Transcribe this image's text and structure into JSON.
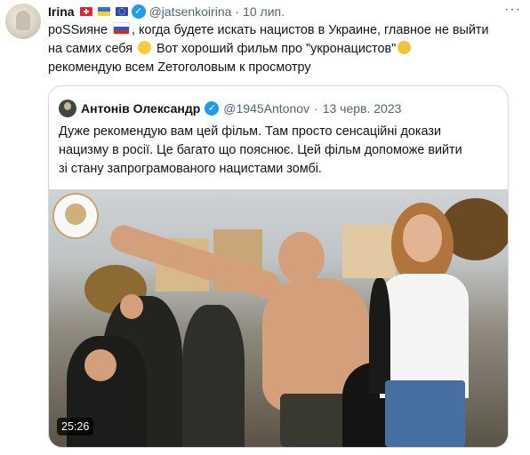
{
  "tweet": {
    "author_name": "Irina",
    "author_handle": "@jatsenkoirina",
    "separator": "·",
    "timestamp": "10 лип.",
    "more_label": "···",
    "lines": [
      "poSSиянe, когда будете искать нацистов в Украине, главное не выйти",
      "на самих себя  Вот хороший фильм про \"укронацистов\"",
      "рекомендую всем Zетоголовым к просмотру"
    ],
    "line1_start": "poSSиянe",
    "line1_end": ", когда будете искать нацистов в Украине, главное не выйти",
    "line2_start": "на самих себя",
    "line2_end": "Вот хороший фильм про \"укронацистов\"",
    "line3": "рекомендую всем Zетоголовым к просмотру"
  },
  "quote": {
    "author_name": "Антонів Олександр",
    "author_handle": "@1945Antonov",
    "separator": "·",
    "timestamp": "13 черв. 2023",
    "text_lines": [
      "Дуже рекомендую вам цей фільм. Там просто сенсаційні докази",
      "нацизму в росії. Це багато що пояснює. Цей фільм допоможе вийти",
      "зі стану запрограмованого нацистами зомбі."
    ]
  },
  "video": {
    "duration": "25:26"
  },
  "icons": {
    "verified": "verified-badge-icon",
    "more": "more-options-icon"
  },
  "colors": {
    "accent": "#1d9bf0",
    "muted": "#536471",
    "border": "#cfd9de"
  }
}
